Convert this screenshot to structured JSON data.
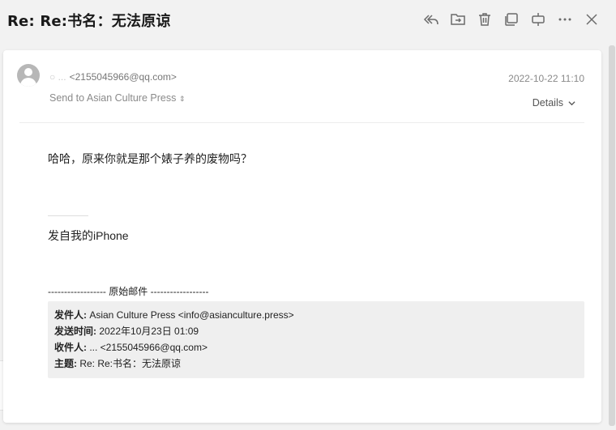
{
  "header": {
    "subject": "Re: Re:书名：无法原谅"
  },
  "toolbar": {
    "buttons": [
      {
        "icon": "reply-all-icon"
      },
      {
        "icon": "move-to-folder-icon"
      },
      {
        "icon": "trash-icon"
      },
      {
        "icon": "open-new-window-icon"
      },
      {
        "icon": "collapse-expand-icon"
      },
      {
        "icon": "more-icon"
      },
      {
        "icon": "close-icon"
      }
    ]
  },
  "message": {
    "sender_name": "○ ...",
    "sender_email": "<2155045966@qq.com>",
    "send_to": "Send to Asian Culture Press",
    "send_to_arrows": "⇕",
    "date": "2022-10-22 11:10",
    "details_label": "Details",
    "body": "哈哈，原来你就是那个婊子养的废物吗？",
    "signature": "发自我的iPhone",
    "original_separator": "------------------ 原始邮件 ------------------",
    "quoted": {
      "from_label": "发件人:",
      "from_value": " Asian Culture Press <info@asianculture.press>",
      "sent_label": "发送时间:",
      "sent_value": " 2022年10月23日 01:09",
      "to_label": "收件人:",
      "to_value": " ... <2155045966@qq.com>",
      "subject_label": "主题:",
      "subject_value": " Re: Re:书名：无法原谅"
    }
  }
}
